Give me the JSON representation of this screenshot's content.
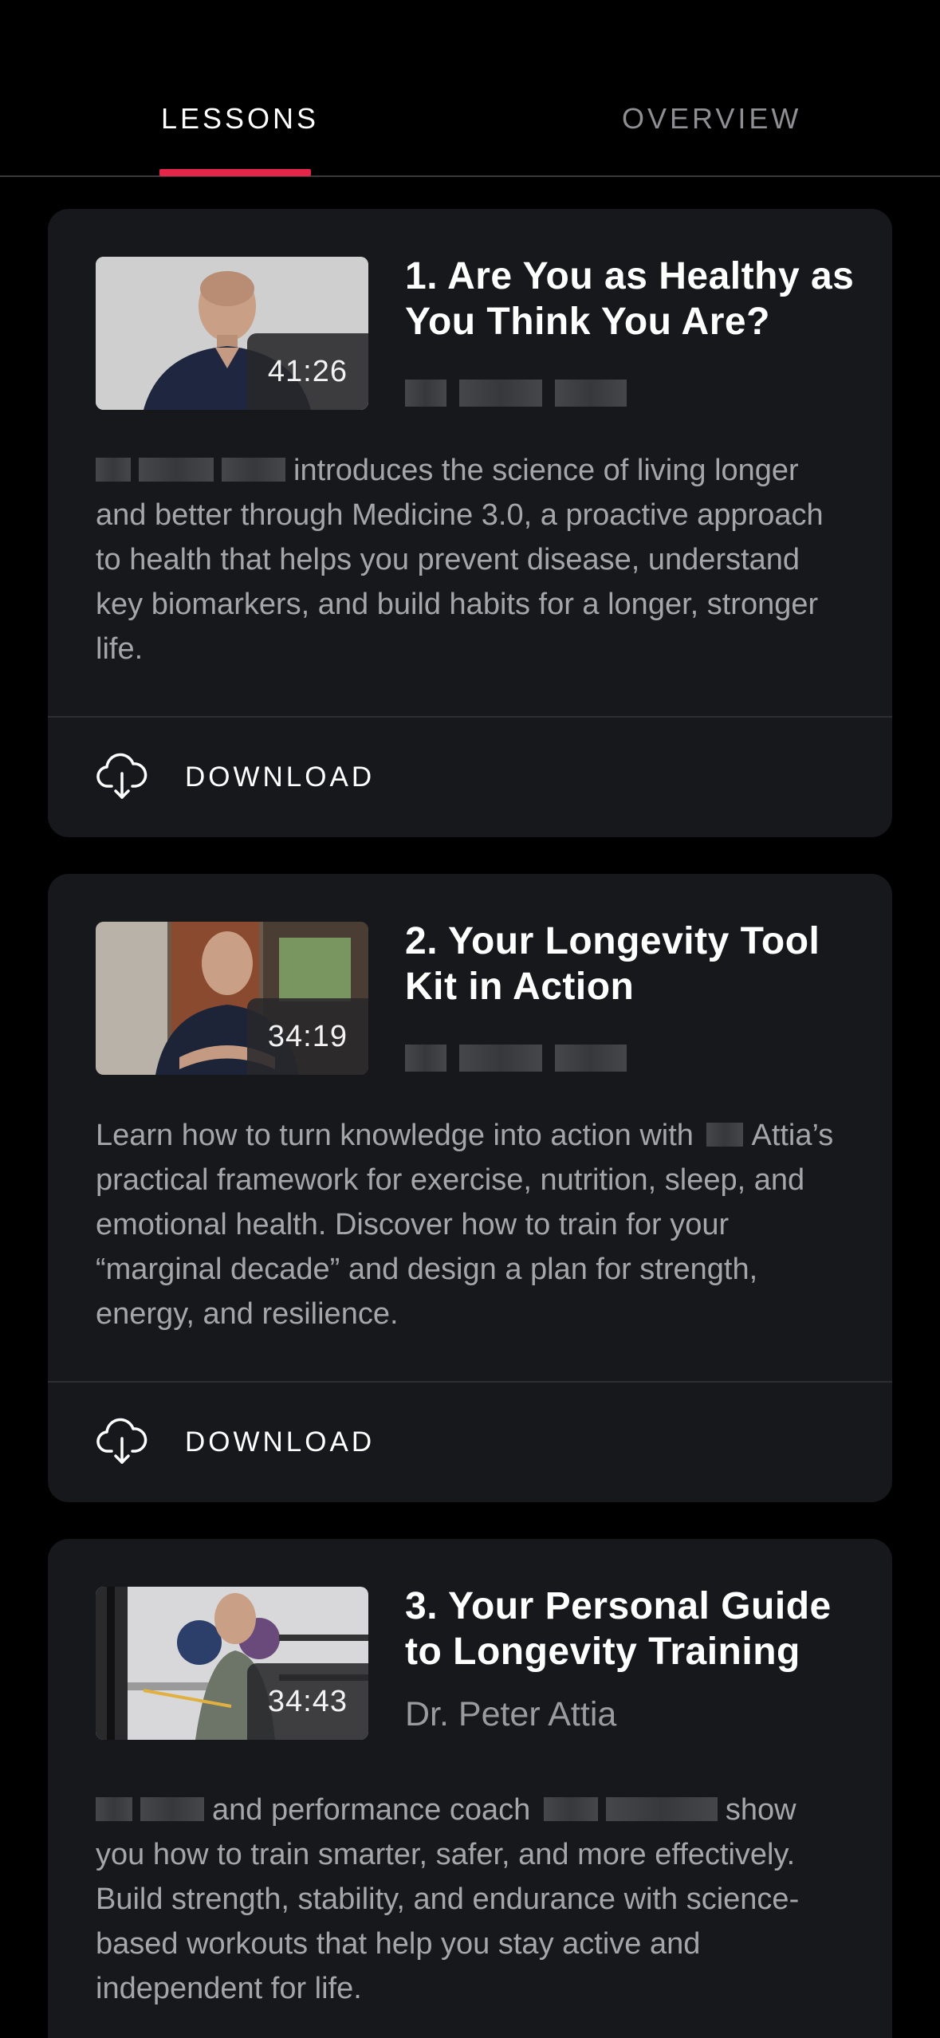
{
  "tabs": {
    "lessons": "LESSONS",
    "overview": "OVERVIEW"
  },
  "colors": {
    "accent": "#e5254a",
    "background": "#000000",
    "card": "#16181c",
    "text_secondary": "#a5a5aa"
  },
  "lessons": [
    {
      "title": "1. Are You as Healthy as You Think You Are?",
      "duration": "41:26",
      "description": "introduces the science of living longer and better through Medicine 3.0, a proactive approach to health that helps you prevent disease, understand key biomarkers, and build habits for a longer, stronger life.",
      "download_label": "DOWNLOAD",
      "download_icon": "cloud-download-icon"
    },
    {
      "title": "2. Your Longevity Tool Kit in Action",
      "duration": "34:19",
      "description_a": "Learn how to turn knowledge into action with",
      "description_b": "Attia’s practical framework for exercise, nutrition, sleep, and emotional health. Discover how to train for your “marginal decade” and design a plan for strength, energy, and resilience.",
      "download_label": "DOWNLOAD",
      "download_icon": "cloud-download-icon"
    },
    {
      "title": "3. Your Personal Guide to Longevity Training",
      "duration": "34:43",
      "author": "Dr. Peter Attia",
      "description_a": "and performance coach",
      "description_b": "show you how to train smarter, safer, and more effectively. Build strength, stability, and endurance with science-based workouts that help you stay active and independent for life."
    }
  ]
}
